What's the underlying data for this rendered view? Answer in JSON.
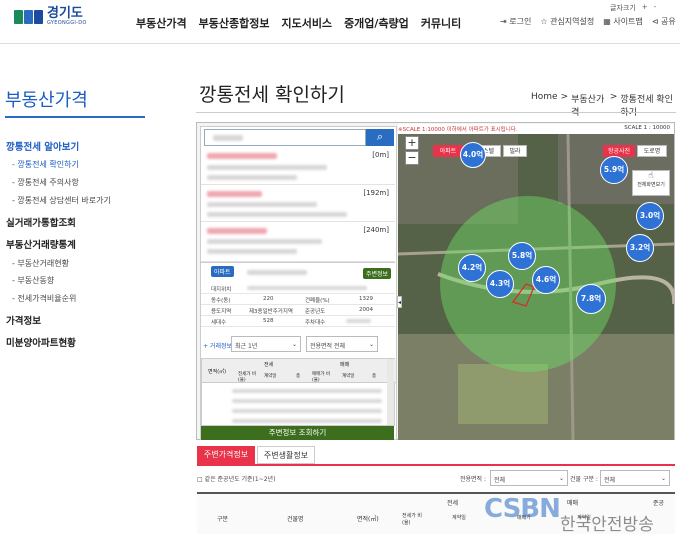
{
  "header": {
    "logo_text": "경기도",
    "logo_sub": "GYEONGGI-DO",
    "menu": [
      "부동산가격",
      "부동산종합정보",
      "지도서비스",
      "중개업/측량업",
      "커뮤니티"
    ],
    "font_size_label": "글자크기",
    "font_plus": "+",
    "font_minus": "-",
    "util": [
      "로그인",
      "관심지역설정",
      "사이트맵",
      "공유"
    ]
  },
  "sidebar": {
    "title": "부동산가격",
    "sections": [
      {
        "label": "깡통전세 알아보기",
        "active": true
      },
      {
        "label": "실거래가통합조회"
      },
      {
        "label": "부동산거래량통계"
      },
      {
        "label": "가격정보"
      },
      {
        "label": "미분양아파트현황"
      }
    ],
    "sub_items_1": [
      "- 깡통전세 확인하기",
      "- 깡통전세 주의사항",
      "- 깡통전세 상담센터 바로가기"
    ],
    "sub_items_3": [
      "- 부동산거래현황",
      "- 부동산동향",
      "- 전세가격비율순위"
    ]
  },
  "page": {
    "title": "깡통전세 확인하기",
    "breadcrumb": [
      "Home",
      ">",
      "부동산가격",
      ">",
      "깡통전세 확인하기"
    ]
  },
  "widget": {
    "search_icon": "search-icon",
    "results": [
      {
        "badge": "[0m]"
      },
      {
        "badge": "[192m]"
      },
      {
        "badge": "[240m]"
      }
    ],
    "detail": {
      "type_tag": "아파트",
      "nearby_tag": "주변정보",
      "rows": [
        {
          "l1": "단지명",
          "v1": "",
          "l2": "",
          "v2": ""
        },
        {
          "l1": "대지위치",
          "v1": "",
          "l2": "",
          "v2": ""
        },
        {
          "l1": "동수(동)",
          "v1": "220",
          "l2": "건폐율(%)",
          "v2": "1329"
        },
        {
          "l1": "용도지역",
          "v1": "제3종일반주거지역",
          "l2": "준공년도",
          "v2": "2004"
        },
        {
          "l1": "세대수",
          "v1": "528",
          "l2": "주차대수",
          "v2": ""
        }
      ]
    },
    "filter": {
      "label": "+ 거래정보",
      "period": "최근 1년",
      "area": "전용면적 전체"
    },
    "table_headers": [
      "면적(㎡)",
      "전세",
      "매매"
    ],
    "table_subheaders": [
      "전세가 비(율)",
      "계약일",
      "층",
      "매매가 비(율)",
      "계약일",
      "층"
    ],
    "table_button": "주변정보 조회하기",
    "map": {
      "scale_note": "※SCALE 1:10000 이하에서 아파트가 표시됩니다.",
      "scale": "SCALE 1 : 10000",
      "tabs": [
        "아파트",
        "오피스텔",
        "빌라"
      ],
      "right_tabs": [
        "항공사진",
        "도로명"
      ],
      "roadview": "전체화면보기",
      "zoom_in": "+",
      "zoom_out": "−",
      "prices": [
        {
          "label": "4.0억",
          "color": "blue"
        },
        {
          "label": "5.9억",
          "color": "blue"
        },
        {
          "label": "3.0억",
          "color": "blue"
        },
        {
          "label": "3.2억",
          "color": "blue"
        },
        {
          "label": "5.8억",
          "color": "blue"
        },
        {
          "label": "4.2억",
          "color": "blue"
        },
        {
          "label": "4.3억",
          "color": "blue"
        },
        {
          "label": "4.6억",
          "color": "blue"
        },
        {
          "label": "7.8억",
          "color": "blue"
        }
      ]
    }
  },
  "bottom": {
    "tabs": [
      "주변가격정보",
      "주변생활정보"
    ],
    "checkbox_label": "□ 같은 준공년도 기준(1~2년)",
    "area_label": "전용면적 :",
    "area_value": "전체",
    "year_label": "건물 구분 :",
    "year_value": "전체",
    "headers": [
      "구분",
      "건물명",
      "면적(㎡)",
      "전세",
      "매매",
      "준공"
    ],
    "subheaders": [
      "전세가 비(율)",
      "계약일",
      "매매가",
      "계약일"
    ]
  },
  "watermark": {
    "logo": "CSBN",
    "text": "한국안전방송"
  },
  "colors": {
    "brand_blue": "#1b5cc4",
    "accent_red": "#e8334a",
    "green_button": "#3c6e1e"
  }
}
